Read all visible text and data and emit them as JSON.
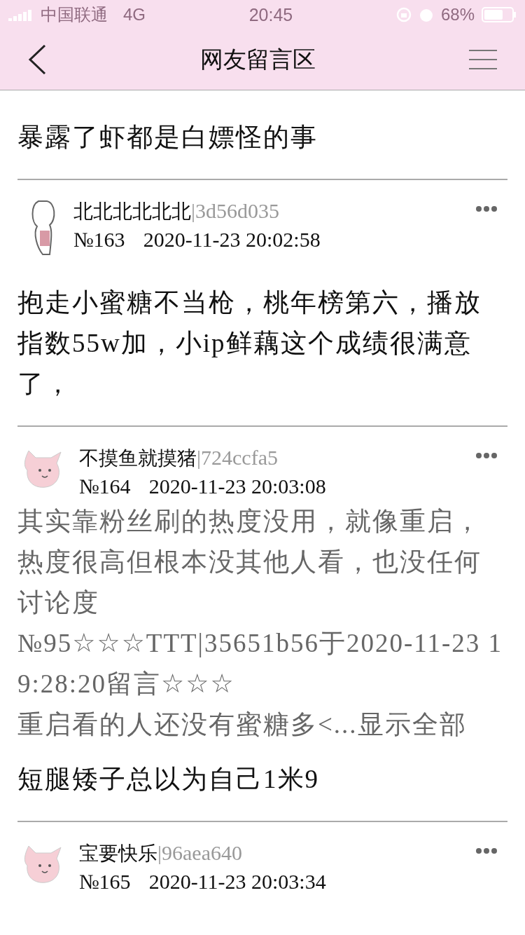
{
  "status_bar": {
    "carrier": "中国联通",
    "network": "4G",
    "time": "20:45",
    "battery": "68%"
  },
  "nav": {
    "title": "网友留言区"
  },
  "top_reply": "暴露了虾都是白嫖怪的事",
  "posts": [
    {
      "kind": "rabbit",
      "name": "北北北北北北",
      "uid": "|3d56d035",
      "number": "№163",
      "time": "2020-11-23 20:02:58",
      "reply": "抱走小蜜糖不当枪，桃年榜第六，播放指数55w加，小ip鲜藕这个成绩很满意了，"
    },
    {
      "kind": "pink",
      "name": "不摸鱼就摸猪",
      "uid": "|724ccfa5",
      "number": "№164",
      "time": "2020-11-23 20:03:08",
      "quote": [
        "其实靠粉丝刷的热度没用，就像重启，热度很高但根本没其他人看，也没任何讨论度",
        "№95☆☆☆TTT|35651b56于2020-11-23 19:28:20留言☆☆☆",
        "重启看的人还没有蜜糖多<...显示全部"
      ],
      "reply": "短腿矮子总以为自己1米9"
    },
    {
      "kind": "pink",
      "name": "宝要快乐",
      "uid": "|96aea640",
      "number": "№165",
      "time": "2020-11-23 20:03:34"
    }
  ]
}
